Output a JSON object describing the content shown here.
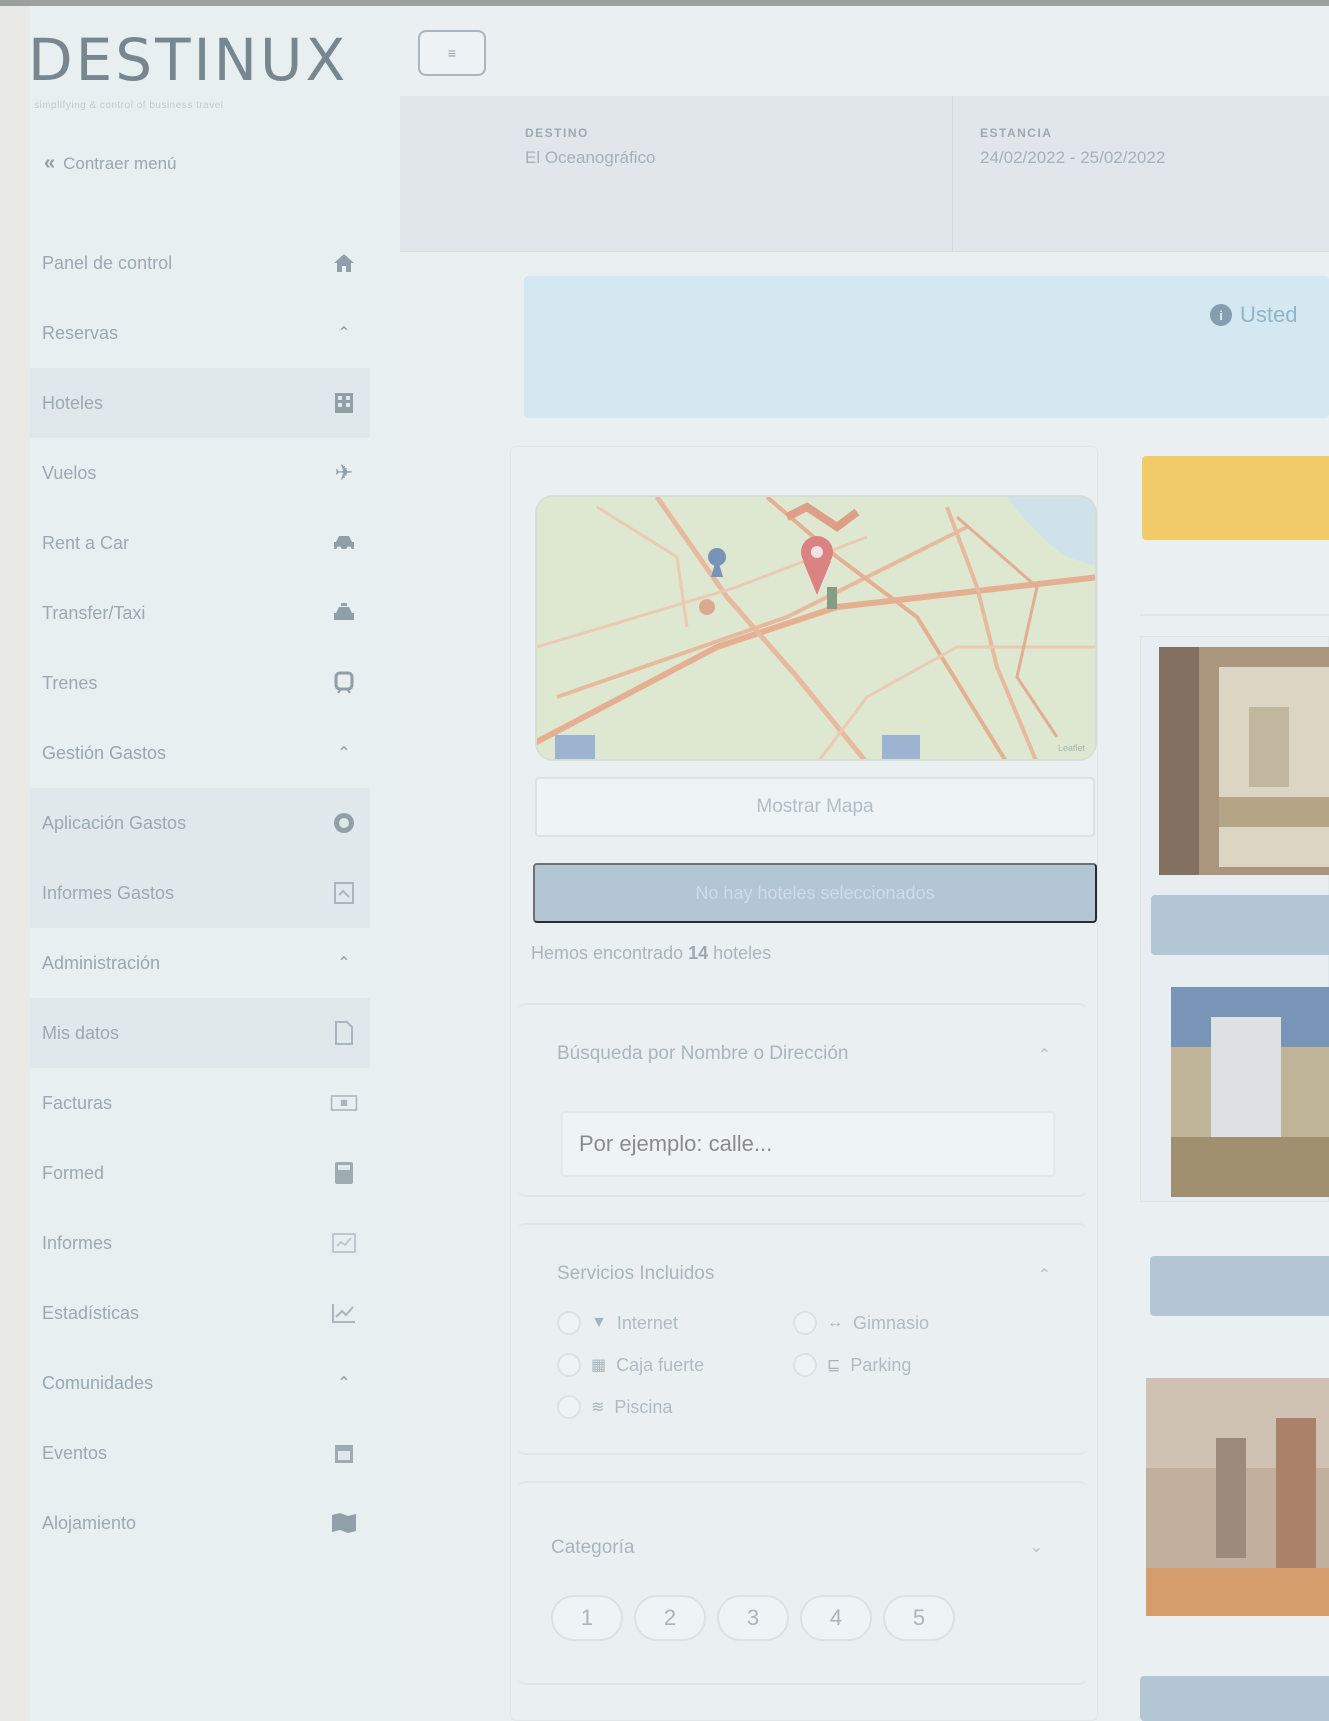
{
  "brand": {
    "logo_text": "DESTINUX",
    "tagline": "simplifying & control of business travel"
  },
  "sidebar": {
    "collapse_label": "Contraer menú",
    "items": [
      {
        "label": "Panel de control",
        "icon": "home-icon",
        "type": "item"
      },
      {
        "label": "Reservas",
        "icon": "chevron-up-icon",
        "type": "section"
      },
      {
        "label": "Hoteles",
        "icon": "building-icon",
        "type": "item",
        "active": true
      },
      {
        "label": "Vuelos",
        "icon": "plane-icon",
        "type": "item"
      },
      {
        "label": "Rent a Car",
        "icon": "car-icon",
        "type": "item"
      },
      {
        "label": "Transfer/Taxi",
        "icon": "taxi-icon",
        "type": "item"
      },
      {
        "label": "Trenes",
        "icon": "train-icon",
        "type": "item"
      },
      {
        "label": "Gestión Gastos",
        "icon": "chevron-up-icon",
        "type": "section"
      },
      {
        "label": "Aplicación Gastos",
        "icon": "coin-icon",
        "type": "item",
        "active": true
      },
      {
        "label": "Informes Gastos",
        "icon": "report-icon",
        "type": "item",
        "active": true
      },
      {
        "label": "Administración",
        "icon": "chevron-up-icon",
        "type": "section"
      },
      {
        "label": "Mis datos",
        "icon": "document-icon",
        "type": "item",
        "active": true
      },
      {
        "label": "Facturas",
        "icon": "invoice-icon",
        "type": "item"
      },
      {
        "label": "Formed",
        "icon": "calculator-icon",
        "type": "item"
      },
      {
        "label": "Informes",
        "icon": "chart-icon",
        "type": "item"
      },
      {
        "label": "Estadísticas",
        "icon": "line-chart-icon",
        "type": "item"
      },
      {
        "label": "Comunidades",
        "icon": "chevron-up-icon",
        "type": "section"
      },
      {
        "label": "Eventos",
        "icon": "calendar-icon",
        "type": "item"
      },
      {
        "label": "Alojamiento",
        "icon": "map-icon",
        "type": "item"
      }
    ]
  },
  "header": {
    "menu_button_label": "≡",
    "destino_label": "DESTINO",
    "destino_value": "El Oceanográfico",
    "estancia_label": "ESTANCIA",
    "estancia_value": "24/02/2022 - 25/02/2022"
  },
  "alert": {
    "icon": "info-icon",
    "text": "Usted"
  },
  "filters": {
    "map_credit": "Leaflet",
    "show_map_button": "Mostrar Mapa",
    "no_selected_button": "No hay hoteles seleccionados",
    "found_prefix": "Hemos encontrado ",
    "found_count": "14",
    "found_suffix": " hoteles",
    "search_section": {
      "title": "Búsqueda por Nombre o Dirección",
      "placeholder": "Por ejemplo: calle..."
    },
    "services_section": {
      "title": "Servicios Incluidos",
      "options": [
        {
          "label": "Internet",
          "icon": "wifi-icon"
        },
        {
          "label": "Gimnasio",
          "icon": "dumbbell-icon"
        },
        {
          "label": "Caja fuerte",
          "icon": "safe-icon"
        },
        {
          "label": "Parking",
          "icon": "parking-icon"
        },
        {
          "label": "Piscina",
          "icon": "pool-icon"
        }
      ]
    },
    "category_section": {
      "title": "Categoría",
      "options": [
        "1",
        "2",
        "3",
        "4",
        "5"
      ]
    }
  },
  "colors": {
    "sort_bar": "#f2c247",
    "primary_button": "#a6bccb",
    "alert_bg": "#cfe6f0"
  }
}
